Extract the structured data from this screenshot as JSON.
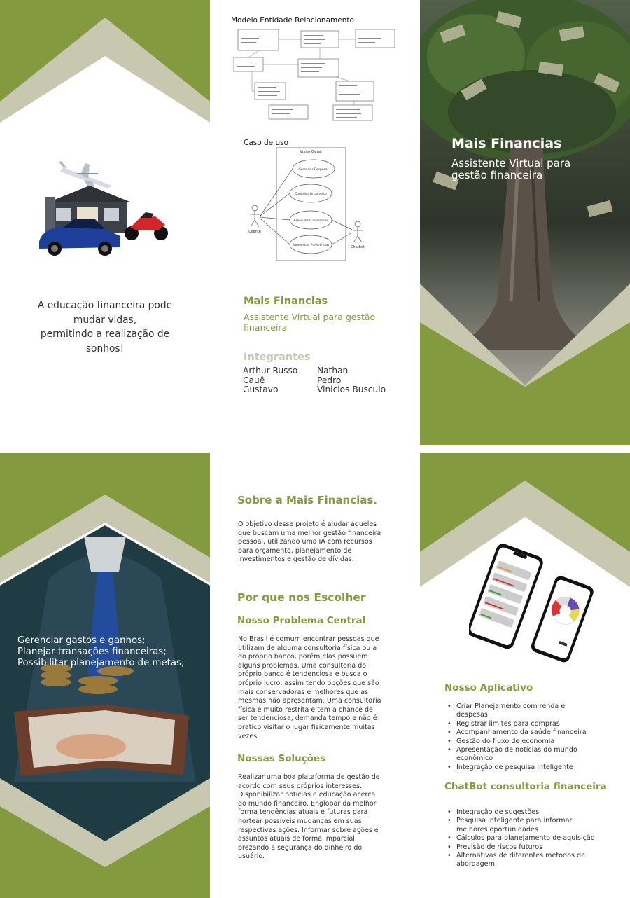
{
  "top_left": {
    "tagline_lines": [
      "A educação financeira pode",
      "mudar vidas,",
      "permitindo a realização de",
      "sonhos!"
    ]
  },
  "top_middle": {
    "erd_title": "Modelo Entidade Relacionamento",
    "use_case_title": "Caso de uso",
    "use_case": {
      "system_label": "Visão Geral",
      "use_cases": [
        "Gerenciar Despesas",
        "Controlar Orçamento",
        "Especializar Interesses",
        "Administrar Preferências"
      ],
      "actors": [
        "Cliente",
        "Chatbot"
      ]
    },
    "brand": "Mais Financias",
    "subtitle": "Assistente Virtual para gestão financeira",
    "members_title": "Integrantes",
    "members_col1": [
      "Arthur Russo",
      "Cauê",
      "Gustavo"
    ],
    "members_col2": [
      "Nathan",
      "Pedro",
      "Vinicios Busculo"
    ]
  },
  "top_right": {
    "brand": "Mais Financias",
    "subtitle": "Assistente Virtual para gestão financeira"
  },
  "bottom_left": {
    "goals": [
      "Gerenciar gastos e ganhos;",
      "Planejar transações financeiras;",
      "Possibilitar planejamento de metas;"
    ]
  },
  "bottom_middle": {
    "about_title": "Sobre a Mais Financias.",
    "about_text": "O objetivo desse projeto é ajudar aqueles que buscam uma melhor gestão financeira pessoal, utilizando uma IA com recursos para orçamento, planejamento de investimentos e gestão de dívidas.",
    "why_title": "Por que nos Escolher",
    "problem_title": "Nosso Problema Central",
    "problem_text": "No Brasil é comum encontrar pessoas que utilizam de alguma consultoria física ou a do próprio banco, porém elas possuem alguns problemas. Uma consultoria do próprio banco é tendenciosa e busca o próprio lucro, assim tendo opções que são mais conservadoras e melhores que as mesmas não apresentam. Uma consultoria física é muito restrita e tem a chance de ser tendenciosa, demanda tempo e não é pratico visitar o lugar fisicamente muitas vezes.",
    "solutions_title": "Nossas Soluções",
    "solutions_text": "Realizar uma boa plataforma de gestão de acordo com seus próprios interesses. Disponibilizar notícias e educação acerca do mundo financeiro. Englobar da melhor forma tendências atuais e futuras para nortear possíveis mudanças em suas respectivas ações. Informar sobre ações e assuntos atuais de forma imparcial, prezando a segurança do dinheiro do usuário."
  },
  "bottom_right": {
    "app_title": "Nosso Aplicativo",
    "app_items": [
      "Criar Planejamento com renda e despesas",
      "Registrar limites para compras",
      "Acompanhamento da saúde financeira",
      "Gestão do fluxo de economia",
      "Apresentação de notícias do mundo econômico",
      "Integração de pesquisa inteligente"
    ],
    "chatbot_title": "ChatBot consultoria financeira",
    "chatbot_items": [
      "Integração de sugestões",
      "Pesquisa inteligente para informar melhores oportunidades",
      "Cálculos para planejamento de aquisição",
      "Previsão de riscos futuros",
      "Alternativas de diferentes métodos de abordagem"
    ]
  },
  "colors": {
    "olive": "#849a3e",
    "beige": "#c8c8b0",
    "dark_tree": "#3e4a33"
  }
}
